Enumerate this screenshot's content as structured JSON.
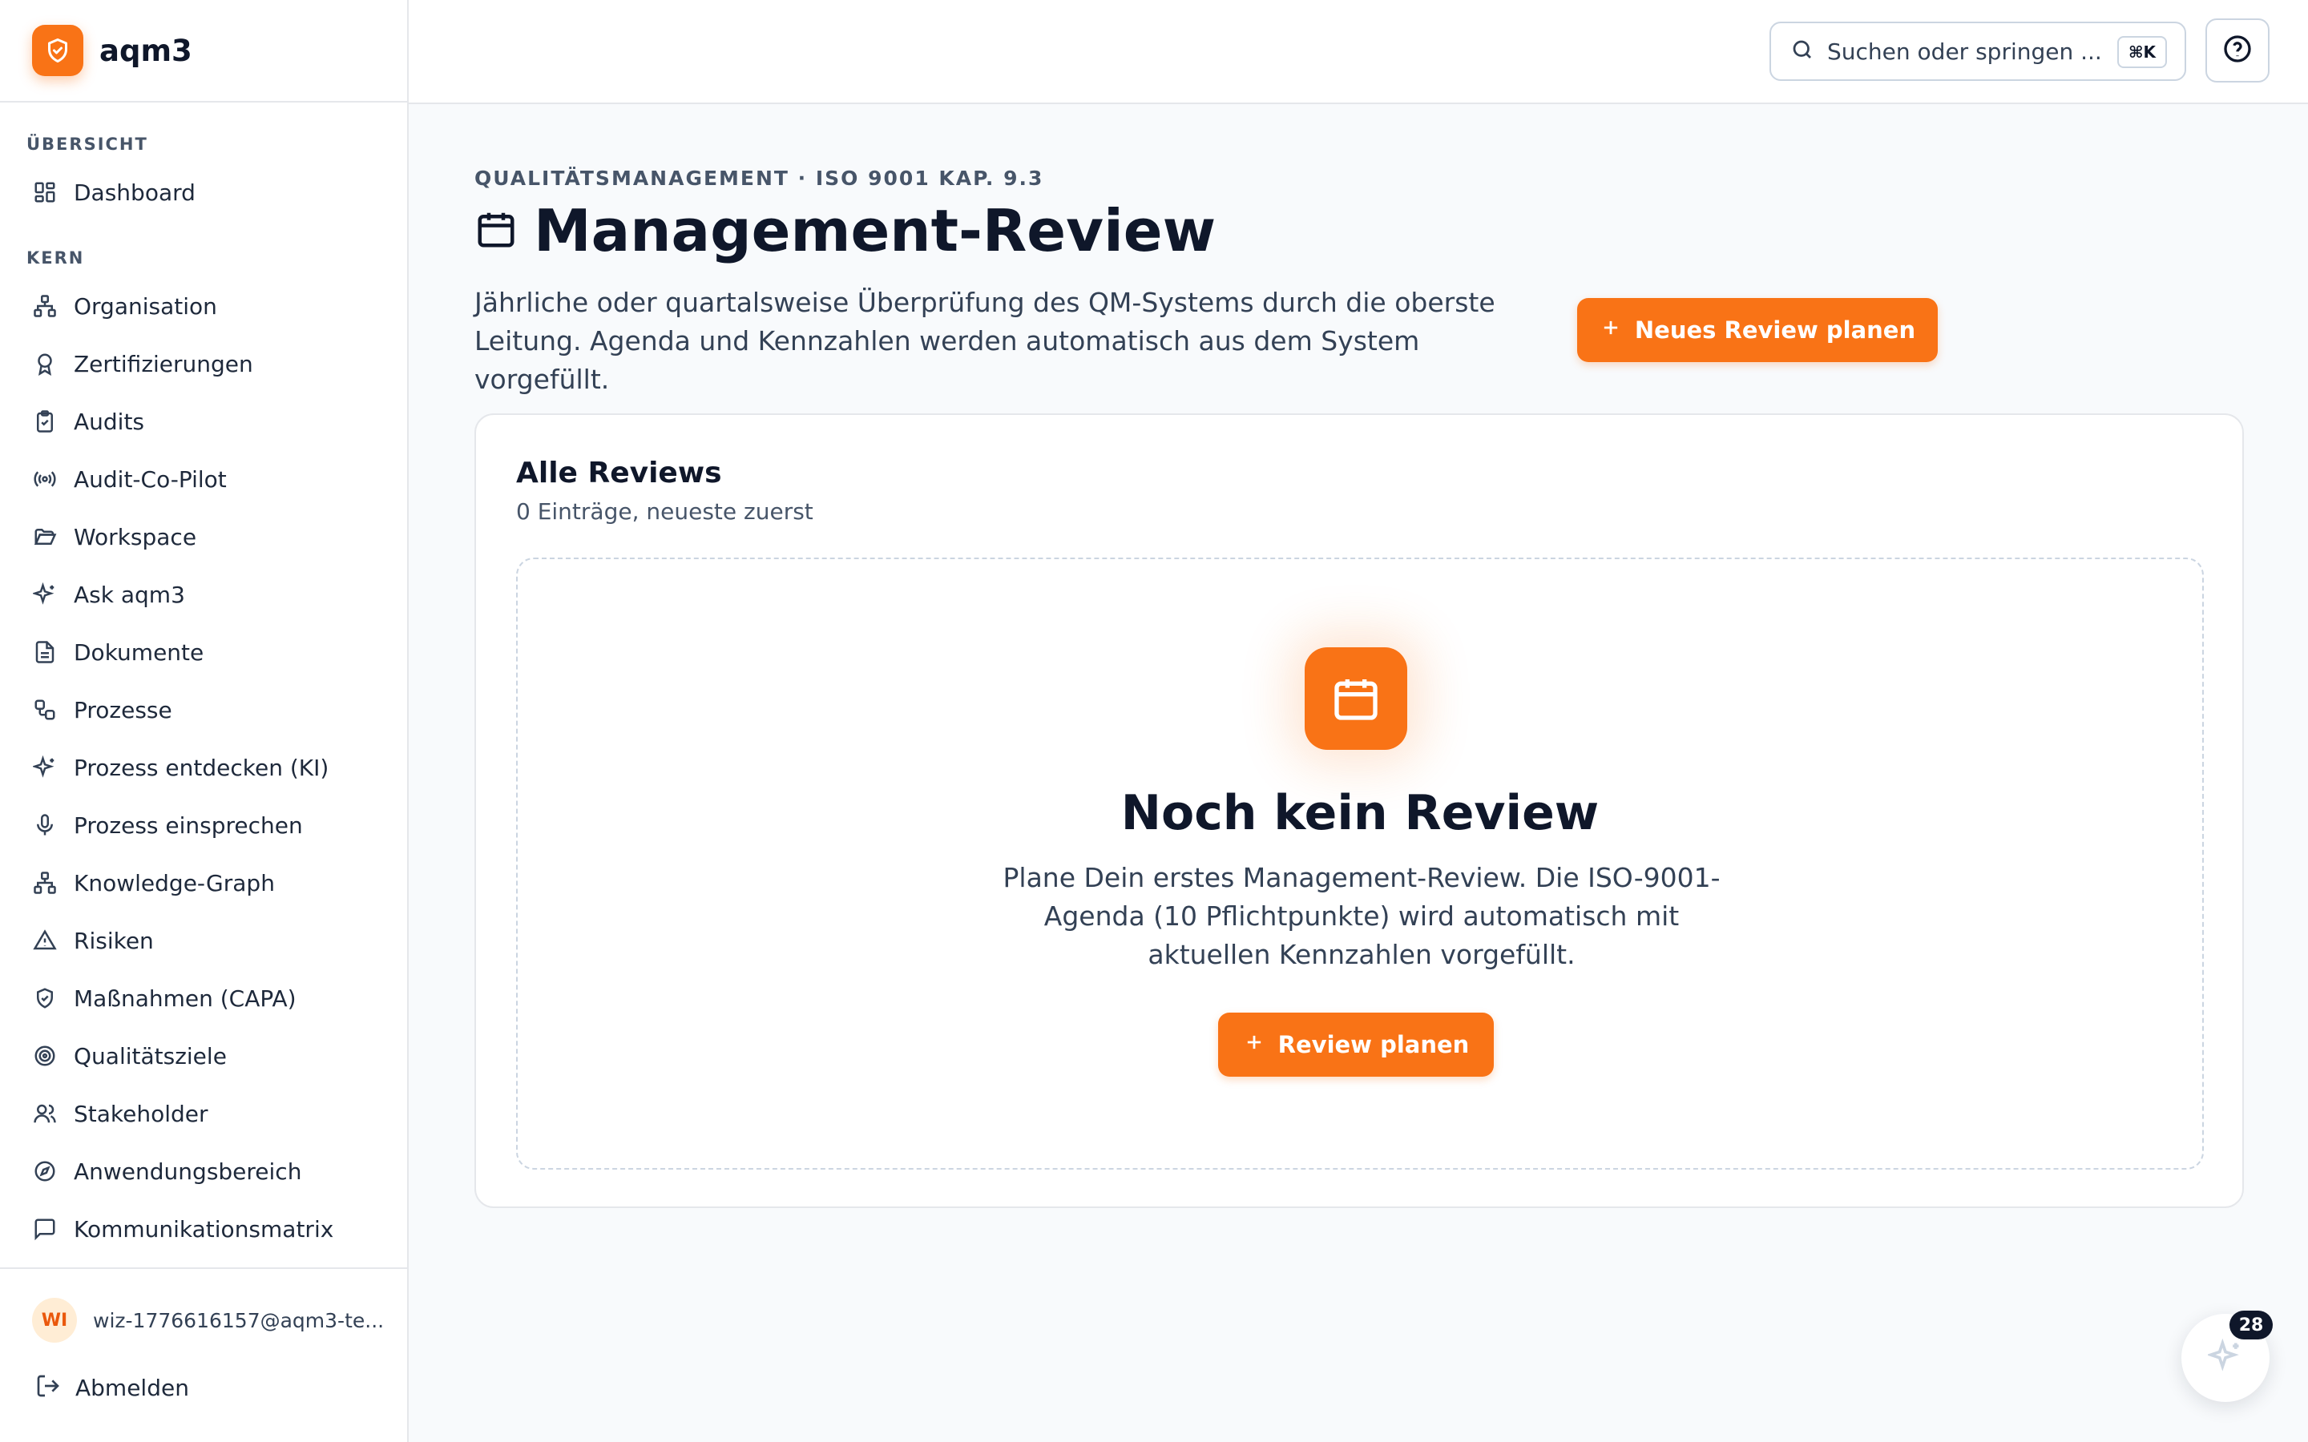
{
  "brand": {
    "name": "aqm3"
  },
  "sidebar": {
    "sections": [
      {
        "title": "ÜBERSICHT",
        "items": [
          {
            "label": "Dashboard",
            "icon": "dashboard-icon"
          }
        ]
      },
      {
        "title": "KERN",
        "items": [
          {
            "label": "Organisation",
            "icon": "org-chart-icon"
          },
          {
            "label": "Zertifizierungen",
            "icon": "award-icon"
          },
          {
            "label": "Audits",
            "icon": "clipboard-check-icon"
          },
          {
            "label": "Audit-Co-Pilot",
            "icon": "radio-icon"
          },
          {
            "label": "Workspace",
            "icon": "folder-open-icon"
          },
          {
            "label": "Ask aqm3",
            "icon": "sparkles-icon"
          },
          {
            "label": "Dokumente",
            "icon": "file-text-icon"
          },
          {
            "label": "Prozesse",
            "icon": "workflow-icon"
          },
          {
            "label": "Prozess entdecken (KI)",
            "icon": "sparkles-icon"
          },
          {
            "label": "Prozess einsprechen",
            "icon": "microphone-icon"
          },
          {
            "label": "Knowledge-Graph",
            "icon": "network-icon"
          },
          {
            "label": "Risiken",
            "icon": "warning-triangle-icon"
          },
          {
            "label": "Maßnahmen (CAPA)",
            "icon": "shield-check-icon"
          },
          {
            "label": "Qualitätsziele",
            "icon": "target-icon"
          },
          {
            "label": "Stakeholder",
            "icon": "users-icon"
          },
          {
            "label": "Anwendungsbereich",
            "icon": "compass-icon"
          },
          {
            "label": "Kommunikationsmatrix",
            "icon": "message-square-icon"
          }
        ]
      }
    ],
    "user": {
      "initials": "WI",
      "email": "wiz-1776616157@aqm3-te..."
    },
    "logout_label": "Abmelden"
  },
  "topbar": {
    "search_placeholder": "Suchen oder springen ...",
    "search_shortcut": "⌘K"
  },
  "main": {
    "eyebrow": "QUALITÄTSMANAGEMENT · ISO 9001 KAP. 9.3",
    "title": "Management-Review",
    "description": "Jährliche oder quartalsweise Überprüfung des QM-Systems durch die oberste Leitung. Agenda und Kennzahlen werden automatisch aus dem System vorgefüllt.",
    "new_button_label": "Neues Review planen",
    "card": {
      "title": "Alle Reviews",
      "subtitle": "0 Einträge, neueste zuerst",
      "empty_title": "Noch kein Review",
      "empty_description": "Plane Dein erstes Management-Review. Die ISO-9001-Agenda (10 Pflichtpunkte) wird automatisch mit aktuellen Kennzahlen vorgefüllt.",
      "empty_button_label": "Review planen"
    }
  },
  "fab": {
    "badge_count": "28"
  },
  "colors": {
    "accent": "#f97316",
    "text": "#0f172a",
    "muted": "#475569",
    "border": "#e5e7eb",
    "background": "#f8fafc"
  }
}
